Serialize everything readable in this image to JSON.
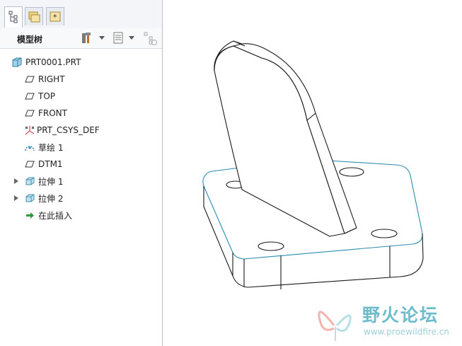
{
  "sidebar": {
    "title": "模型树",
    "items": [
      {
        "label": "PRT0001.PRT",
        "icon": "part-icon"
      },
      {
        "label": "RIGHT",
        "icon": "datum-plane-icon"
      },
      {
        "label": "TOP",
        "icon": "datum-plane-icon"
      },
      {
        "label": "FRONT",
        "icon": "datum-plane-icon"
      },
      {
        "label": "PRT_CSYS_DEF",
        "icon": "csys-icon"
      },
      {
        "label": "草绘 1",
        "icon": "sketch-icon"
      },
      {
        "label": "DTM1",
        "icon": "datum-plane-icon"
      },
      {
        "label": "拉伸 1",
        "icon": "extrude-icon"
      },
      {
        "label": "拉伸 2",
        "icon": "extrude-icon"
      },
      {
        "label": "在此插入",
        "icon": "insert-arrow-icon"
      }
    ]
  },
  "watermark": {
    "title": "野火论坛",
    "url": "www.proewildfire.cn"
  },
  "colors": {
    "edge": "#1a1a1a",
    "selected_edge": "#2a8db0",
    "accent": "#6cbccc"
  }
}
